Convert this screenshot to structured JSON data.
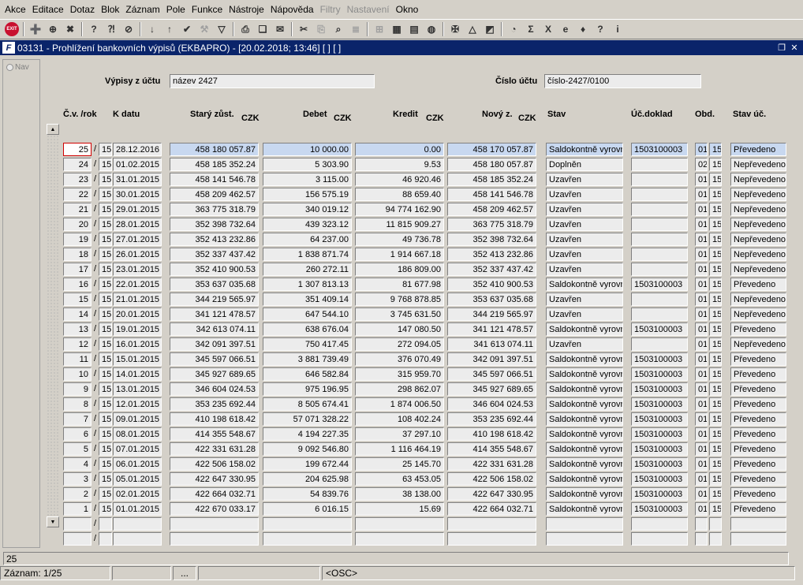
{
  "menu": [
    "Akce",
    "Editace",
    "Dotaz",
    "Blok",
    "Záznam",
    "Pole",
    "Funkce",
    "Nástroje",
    "Nápověda",
    "Filtry",
    "Nastavení",
    "Okno"
  ],
  "menu_disabled": [
    "Filtry",
    "Nastavení"
  ],
  "toolbar": {
    "exit_label": "EXIT",
    "icons": [
      "add-record-icon",
      "add-record-alt-icon",
      "delete-record-icon",
      "query-icon",
      "query-run-icon",
      "query-cancel-icon",
      "sort-asc-icon",
      "sort-desc-icon",
      "commit-check-icon",
      "wrench-icon",
      "filter-icon",
      "print-icon",
      "copy-icon",
      "mail-icon",
      "scissors-icon",
      "paste-icon",
      "zoom-icon",
      "list-icon",
      "tree-icon",
      "calculator-icon",
      "book-icon",
      "globe-icon",
      "cross-icon",
      "warning-icon",
      "chart-icon",
      "report-icon",
      "sum-icon",
      "excel-icon",
      "internet-icon",
      "tools-icon",
      "help-icon",
      "info-icon"
    ]
  },
  "window": {
    "title": "03131 - Prohlížení bankovních výpisů (EKBAPRO) - [20.02.2018; 13:46]  [ ]  [ ]",
    "icon_label": "F"
  },
  "nav": {
    "label": "Nav"
  },
  "header": {
    "account_label": "Výpisy z účtu",
    "account_value": "název 2427",
    "number_label": "Číslo účtu",
    "number_value": "číslo-2427/0100"
  },
  "columns": {
    "cv": "Č.v. /rok",
    "kdatu": "K datu",
    "stary": "Starý zůst.",
    "debet": "Debet",
    "kredit": "Kredit",
    "novy": "Nový z.",
    "stav": "Stav",
    "ucdoklad": "Úč.doklad",
    "obd": "Obd.",
    "stavuc": "Stav úč.",
    "currency": "CZK"
  },
  "rows": [
    {
      "cv": "25",
      "rok": "15",
      "datum": "28.12.2016",
      "stary": "458 180 057.87",
      "debet": "10 000.00",
      "kredit": "0.00",
      "novy": "458 170 057.87",
      "stav": "Saldokontně vyrovn",
      "doklad": "1503100003",
      "obd1": "01",
      "obd2": "15",
      "stavuc": "Převedeno"
    },
    {
      "cv": "24",
      "rok": "15",
      "datum": "01.02.2015",
      "stary": "458 185 352.24",
      "debet": "5 303.90",
      "kredit": "9.53",
      "novy": "458 180 057.87",
      "stav": "Doplněn",
      "doklad": "",
      "obd1": "02",
      "obd2": "15",
      "stavuc": "Nepřevedeno"
    },
    {
      "cv": "23",
      "rok": "15",
      "datum": "31.01.2015",
      "stary": "458 141 546.78",
      "debet": "3 115.00",
      "kredit": "46 920.46",
      "novy": "458 185 352.24",
      "stav": "Uzavřen",
      "doklad": "",
      "obd1": "01",
      "obd2": "15",
      "stavuc": "Nepřevedeno"
    },
    {
      "cv": "22",
      "rok": "15",
      "datum": "30.01.2015",
      "stary": "458 209 462.57",
      "debet": "156 575.19",
      "kredit": "88 659.40",
      "novy": "458 141 546.78",
      "stav": "Uzavřen",
      "doklad": "",
      "obd1": "01",
      "obd2": "15",
      "stavuc": "Nepřevedeno"
    },
    {
      "cv": "21",
      "rok": "15",
      "datum": "29.01.2015",
      "stary": "363 775 318.79",
      "debet": "340 019.12",
      "kredit": "94 774 162.90",
      "novy": "458 209 462.57",
      "stav": "Uzavřen",
      "doklad": "",
      "obd1": "01",
      "obd2": "15",
      "stavuc": "Nepřevedeno"
    },
    {
      "cv": "20",
      "rok": "15",
      "datum": "28.01.2015",
      "stary": "352 398 732.64",
      "debet": "439 323.12",
      "kredit": "11 815 909.27",
      "novy": "363 775 318.79",
      "stav": "Uzavřen",
      "doklad": "",
      "obd1": "01",
      "obd2": "15",
      "stavuc": "Nepřevedeno"
    },
    {
      "cv": "19",
      "rok": "15",
      "datum": "27.01.2015",
      "stary": "352 413 232.86",
      "debet": "64 237.00",
      "kredit": "49 736.78",
      "novy": "352 398 732.64",
      "stav": "Uzavřen",
      "doklad": "",
      "obd1": "01",
      "obd2": "15",
      "stavuc": "Nepřevedeno"
    },
    {
      "cv": "18",
      "rok": "15",
      "datum": "26.01.2015",
      "stary": "352 337 437.42",
      "debet": "1 838 871.74",
      "kredit": "1 914 667.18",
      "novy": "352 413 232.86",
      "stav": "Uzavřen",
      "doklad": "",
      "obd1": "01",
      "obd2": "15",
      "stavuc": "Nepřevedeno"
    },
    {
      "cv": "17",
      "rok": "15",
      "datum": "23.01.2015",
      "stary": "352 410 900.53",
      "debet": "260 272.11",
      "kredit": "186 809.00",
      "novy": "352 337 437.42",
      "stav": "Uzavřen",
      "doklad": "",
      "obd1": "01",
      "obd2": "15",
      "stavuc": "Nepřevedeno"
    },
    {
      "cv": "16",
      "rok": "15",
      "datum": "22.01.2015",
      "stary": "353 637 035.68",
      "debet": "1 307 813.13",
      "kredit": "81 677.98",
      "novy": "352 410 900.53",
      "stav": "Saldokontně vyrovn",
      "doklad": "1503100003",
      "obd1": "01",
      "obd2": "15",
      "stavuc": "Převedeno"
    },
    {
      "cv": "15",
      "rok": "15",
      "datum": "21.01.2015",
      "stary": "344 219 565.97",
      "debet": "351 409.14",
      "kredit": "9 768 878.85",
      "novy": "353 637 035.68",
      "stav": "Uzavřen",
      "doklad": "",
      "obd1": "01",
      "obd2": "15",
      "stavuc": "Nepřevedeno"
    },
    {
      "cv": "14",
      "rok": "15",
      "datum": "20.01.2015",
      "stary": "341 121 478.57",
      "debet": "647 544.10",
      "kredit": "3 745 631.50",
      "novy": "344 219 565.97",
      "stav": "Uzavřen",
      "doklad": "",
      "obd1": "01",
      "obd2": "15",
      "stavuc": "Nepřevedeno"
    },
    {
      "cv": "13",
      "rok": "15",
      "datum": "19.01.2015",
      "stary": "342 613 074.11",
      "debet": "638 676.04",
      "kredit": "147 080.50",
      "novy": "341 121 478.57",
      "stav": "Saldokontně vyrovn",
      "doklad": "1503100003",
      "obd1": "01",
      "obd2": "15",
      "stavuc": "Převedeno"
    },
    {
      "cv": "12",
      "rok": "15",
      "datum": "16.01.2015",
      "stary": "342 091 397.51",
      "debet": "750 417.45",
      "kredit": "272 094.05",
      "novy": "341 613 074.11",
      "stav": "Uzavřen",
      "doklad": "",
      "obd1": "01",
      "obd2": "15",
      "stavuc": "Nepřevedeno"
    },
    {
      "cv": "11",
      "rok": "15",
      "datum": "15.01.2015",
      "stary": "345 597 066.51",
      "debet": "3 881 739.49",
      "kredit": "376 070.49",
      "novy": "342 091 397.51",
      "stav": "Saldokontně vyrovn",
      "doklad": "1503100003",
      "obd1": "01",
      "obd2": "15",
      "stavuc": "Převedeno"
    },
    {
      "cv": "10",
      "rok": "15",
      "datum": "14.01.2015",
      "stary": "345 927 689.65",
      "debet": "646 582.84",
      "kredit": "315 959.70",
      "novy": "345 597 066.51",
      "stav": "Saldokontně vyrovn",
      "doklad": "1503100003",
      "obd1": "01",
      "obd2": "15",
      "stavuc": "Převedeno"
    },
    {
      "cv": "9",
      "rok": "15",
      "datum": "13.01.2015",
      "stary": "346 604 024.53",
      "debet": "975 196.95",
      "kredit": "298 862.07",
      "novy": "345 927 689.65",
      "stav": "Saldokontně vyrovn",
      "doklad": "1503100003",
      "obd1": "01",
      "obd2": "15",
      "stavuc": "Převedeno"
    },
    {
      "cv": "8",
      "rok": "15",
      "datum": "12.01.2015",
      "stary": "353 235 692.44",
      "debet": "8 505 674.41",
      "kredit": "1 874 006.50",
      "novy": "346 604 024.53",
      "stav": "Saldokontně vyrovn",
      "doklad": "1503100003",
      "obd1": "01",
      "obd2": "15",
      "stavuc": "Převedeno"
    },
    {
      "cv": "7",
      "rok": "15",
      "datum": "09.01.2015",
      "stary": "410 198 618.42",
      "debet": "57 071 328.22",
      "kredit": "108 402.24",
      "novy": "353 235 692.44",
      "stav": "Saldokontně vyrovn",
      "doklad": "1503100003",
      "obd1": "01",
      "obd2": "15",
      "stavuc": "Převedeno"
    },
    {
      "cv": "6",
      "rok": "15",
      "datum": "08.01.2015",
      "stary": "414 355 548.67",
      "debet": "4 194 227.35",
      "kredit": "37 297.10",
      "novy": "410 198 618.42",
      "stav": "Saldokontně vyrovn",
      "doklad": "1503100003",
      "obd1": "01",
      "obd2": "15",
      "stavuc": "Převedeno"
    },
    {
      "cv": "5",
      "rok": "15",
      "datum": "07.01.2015",
      "stary": "422 331 631.28",
      "debet": "9 092 546.80",
      "kredit": "1 116 464.19",
      "novy": "414 355 548.67",
      "stav": "Saldokontně vyrovn",
      "doklad": "1503100003",
      "obd1": "01",
      "obd2": "15",
      "stavuc": "Převedeno"
    },
    {
      "cv": "4",
      "rok": "15",
      "datum": "06.01.2015",
      "stary": "422 506 158.02",
      "debet": "199 672.44",
      "kredit": "25 145.70",
      "novy": "422 331 631.28",
      "stav": "Saldokontně vyrovn",
      "doklad": "1503100003",
      "obd1": "01",
      "obd2": "15",
      "stavuc": "Převedeno"
    },
    {
      "cv": "3",
      "rok": "15",
      "datum": "05.01.2015",
      "stary": "422 647 330.95",
      "debet": "204 625.98",
      "kredit": "63 453.05",
      "novy": "422 506 158.02",
      "stav": "Saldokontně vyrovn",
      "doklad": "1503100003",
      "obd1": "01",
      "obd2": "15",
      "stavuc": "Převedeno"
    },
    {
      "cv": "2",
      "rok": "15",
      "datum": "02.01.2015",
      "stary": "422 664 032.71",
      "debet": "54 839.76",
      "kredit": "38 138.00",
      "novy": "422 647 330.95",
      "stav": "Saldokontně vyrovn",
      "doklad": "1503100003",
      "obd1": "01",
      "obd2": "15",
      "stavuc": "Převedeno"
    },
    {
      "cv": "1",
      "rok": "15",
      "datum": "01.01.2015",
      "stary": "422 670 033.17",
      "debet": "6 016.15",
      "kredit": "15.69",
      "novy": "422 664 032.71",
      "stav": "Saldokontně vyrovn",
      "doklad": "1503100003",
      "obd1": "01",
      "obd2": "15",
      "stavuc": "Převedeno"
    },
    {
      "cv": "",
      "rok": "",
      "datum": "",
      "stary": "",
      "debet": "",
      "kredit": "",
      "novy": "",
      "stav": "",
      "doklad": "",
      "obd1": "",
      "obd2": "",
      "stavuc": ""
    },
    {
      "cv": "",
      "rok": "",
      "datum": "",
      "stary": "",
      "debet": "",
      "kredit": "",
      "novy": "",
      "stav": "",
      "doklad": "",
      "obd1": "",
      "obd2": "",
      "stavuc": ""
    }
  ],
  "status": {
    "echo": "25",
    "record": "Záznam: 1/25",
    "seg3": "...",
    "osc": "<OSC>"
  },
  "colors": {
    "titlebar": "#0a246a",
    "selection": "#c8d8f0",
    "focus_border": "#d00000"
  }
}
